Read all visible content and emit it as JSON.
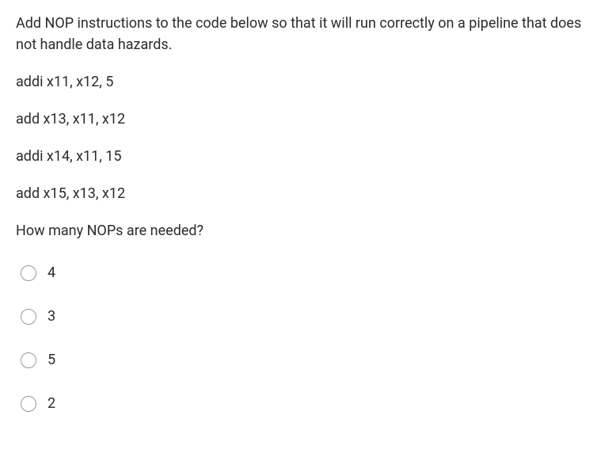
{
  "question": {
    "intro": "Add NOP instructions to the code below so that it will run correctly on a pipeline that does not handle data hazards.",
    "code_lines": [
      "addi x11, x12, 5",
      "add x13, x11, x12",
      "addi x14, x11, 15",
      "add x15, x13, x12"
    ],
    "prompt": "How many NOPs are needed?",
    "options": [
      {
        "label": "4"
      },
      {
        "label": "3"
      },
      {
        "label": "5"
      },
      {
        "label": "2"
      }
    ]
  }
}
